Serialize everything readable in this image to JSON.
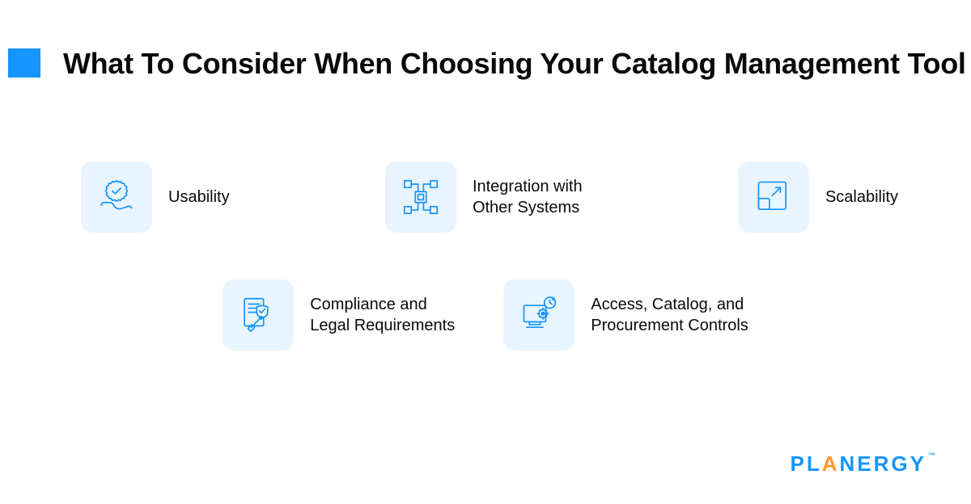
{
  "title": "What To Consider When Choosing Your Catalog Management Tool",
  "items": [
    {
      "label": "Usability"
    },
    {
      "label": "Integration with\nOther Systems"
    },
    {
      "label": "Scalability"
    },
    {
      "label": "Compliance and\nLegal Requirements"
    },
    {
      "label": "Access, Catalog, and\nProcurement Controls"
    }
  ],
  "logo": {
    "text": "PLANERGY",
    "tm": "™"
  },
  "colors": {
    "accent": "#1495ff",
    "iconBg": "#e8f4ff",
    "logoOrange": "#ff9933"
  }
}
